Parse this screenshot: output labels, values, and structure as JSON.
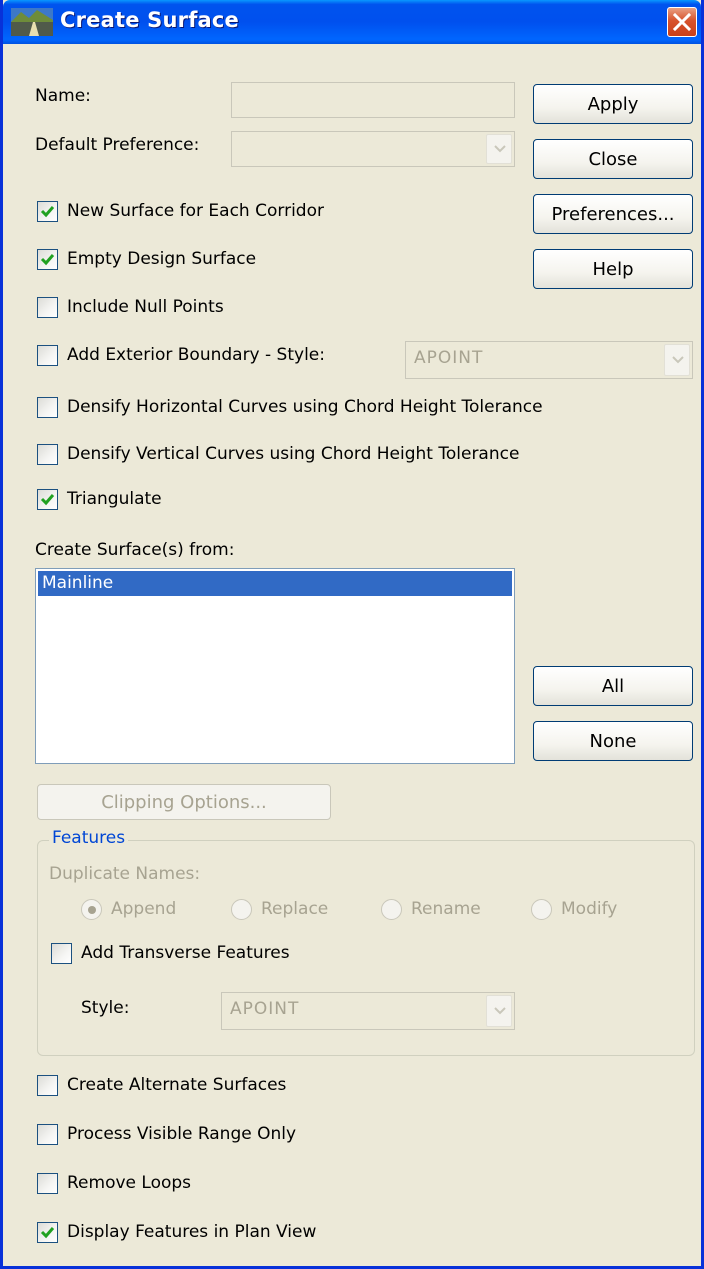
{
  "window": {
    "title": "Create Surface"
  },
  "form": {
    "name_label": "Name:",
    "name_value": "",
    "default_pref_label": "Default Preference:",
    "default_pref_value": ""
  },
  "buttons": {
    "apply": "Apply",
    "close": "Close",
    "preferences": "Preferences...",
    "help": "Help",
    "all": "All",
    "none": "None",
    "clipping": "Clipping Options..."
  },
  "options": [
    {
      "label": "New Surface for Each Corridor",
      "checked": true
    },
    {
      "label": "Empty Design Surface",
      "checked": true
    },
    {
      "label": "Include Null Points",
      "checked": false
    },
    {
      "label": "Add Exterior Boundary - Style:",
      "checked": false
    },
    {
      "label": "Densify Horizontal Curves using Chord Height Tolerance",
      "checked": false
    },
    {
      "label": "Densify Vertical Curves using Chord Height Tolerance",
      "checked": false
    },
    {
      "label": "Triangulate",
      "checked": true
    }
  ],
  "exterior_style": {
    "value": "APOINT"
  },
  "create_from": {
    "label": "Create Surface(s) from:",
    "items": [
      "Mainline"
    ]
  },
  "features": {
    "title": "Features",
    "duplicate_label": "Duplicate Names:",
    "radios": [
      {
        "label": "Append",
        "selected": true
      },
      {
        "label": "Replace",
        "selected": false
      },
      {
        "label": "Rename",
        "selected": false
      },
      {
        "label": "Modify",
        "selected": false
      }
    ],
    "transverse_label": "Add Transverse Features",
    "transverse_checked": false,
    "style_label": "Style:",
    "style_value": "APOINT"
  },
  "bottom_options": [
    {
      "label": "Create Alternate Surfaces",
      "checked": false
    },
    {
      "label": "Process Visible Range Only",
      "checked": false
    },
    {
      "label": "Remove Loops",
      "checked": false
    },
    {
      "label": "Display Features in Plan View",
      "checked": true
    }
  ],
  "colors": {
    "titlebar": "#0054E3",
    "dialog_bg": "#ECE9D8",
    "selection": "#316AC5",
    "check_green": "#21A121",
    "group_title": "#0046D5"
  }
}
